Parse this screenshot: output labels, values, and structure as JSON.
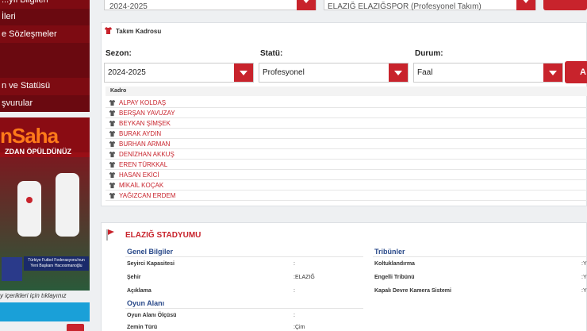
{
  "sidebar": {
    "items": [
      {
        "label": "...yıl Bilgileri"
      },
      {
        "label": "İleri"
      },
      {
        "label": "e Sözleşmeler"
      },
      {
        "label": "n ve Statüsü"
      },
      {
        "label": "şvurular"
      }
    ]
  },
  "ad": {
    "logo": "nSaha",
    "subtitle": "ZDAN ÖPÜLDÜNÜZ",
    "caption": "Türkiye Futbol Federasyonu'nun Yeni Başkanı Hacıosmanoğlu",
    "link": "y içerikleri için tıklayınız"
  },
  "top_filters": {
    "season": "2024-2025",
    "club": "ELAZIĞ ELAZIĞSPOR (Profesyonel Takım)"
  },
  "squad": {
    "title": "Takım Kadrosu",
    "season_label": "Sezon:",
    "season_value": "2024-2025",
    "status_label": "Statü:",
    "status_value": "Profesyonel",
    "state_label": "Durum:",
    "state_value": "Faal",
    "button_label": "A",
    "list_header": "Kadro",
    "players": [
      "ALPAY KOLDAŞ",
      "BERŞAN YAVUZAY",
      "BEYKAN ŞİMŞEK",
      "BURAK AYDIN",
      "BURHAN ARMAN",
      "DENİZHAN AKKUŞ",
      "EREN TÜRKKAL",
      "HASAN EKİCİ",
      "MİKAİL KOÇAK",
      "YAĞIZCAN ERDEM"
    ]
  },
  "stadium": {
    "title": "ELAZIĞ STADYUMU",
    "general": {
      "heading": "Genel Bilgiler",
      "rows": [
        {
          "key": "Seyirci Kapasitesi",
          "value": ":"
        },
        {
          "key": "Şehir",
          "value": ":ELAZIĞ"
        },
        {
          "key": "Açıklama",
          "value": ":"
        }
      ]
    },
    "field": {
      "heading": "Oyun Alanı",
      "rows": [
        {
          "key": "Oyun Alanı Ölçüsü",
          "value": ":"
        },
        {
          "key": "Zemin Türü",
          "value": ":Çim"
        }
      ]
    },
    "stands": {
      "heading": "Tribünler",
      "rows": [
        {
          "key": "Koltuklandırma",
          "value": ":Y"
        },
        {
          "key": "Engelli Tribünü",
          "value": ":Y"
        },
        {
          "key": "Kapalı Devre Kamera Sistemi",
          "value": ":Y"
        }
      ]
    }
  },
  "colors": {
    "brand_red": "#c8232c",
    "sidebar": "#7d0b12",
    "section_blue": "#2a4a8a"
  },
  "icons": {
    "shirt": "shirt-icon",
    "dropdown": "chevron-down-icon",
    "flag": "flag-icon"
  }
}
